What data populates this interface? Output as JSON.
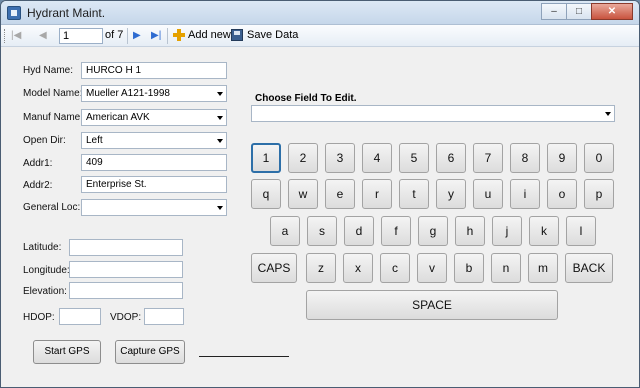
{
  "window": {
    "title": "Hydrant Maint.",
    "controls": {
      "minimize": "–",
      "maximize": "□",
      "close": "✕"
    }
  },
  "navigator": {
    "position": "1",
    "count_label": "of 7",
    "add_label": "Add new",
    "save_label": "Save Data"
  },
  "form": {
    "hyd_name": {
      "label": "Hyd Name:",
      "value": "HURCO H 1"
    },
    "model_name": {
      "label": "Model Name:",
      "value": "Mueller A121-1998"
    },
    "manuf_name": {
      "label": "Manuf Name:",
      "value": "American AVK"
    },
    "open_dir": {
      "label": "Open Dir:",
      "value": "Left"
    },
    "addr1": {
      "label": "Addr1:",
      "value": "409"
    },
    "addr2": {
      "label": "Addr2:",
      "value": "Enterprise St."
    },
    "general_loc": {
      "label": "General Loc:",
      "value": ""
    },
    "latitude": {
      "label": "Latitude:",
      "value": ""
    },
    "longitude": {
      "label": "Longitude:",
      "value": ""
    },
    "elevation": {
      "label": "Elevation:",
      "value": ""
    },
    "hdop": {
      "label": "HDOP:",
      "value": ""
    },
    "vdop": {
      "label": "VDOP:",
      "value": ""
    }
  },
  "buttons": {
    "start_gps": "Start GPS",
    "capture_gps": "Capture GPS"
  },
  "editor": {
    "choose_label": "Choose Field To Edit.",
    "selected": ""
  },
  "keyboard": {
    "row1": [
      "1",
      "2",
      "3",
      "4",
      "5",
      "6",
      "7",
      "8",
      "9",
      "0"
    ],
    "row2": [
      "q",
      "w",
      "e",
      "r",
      "t",
      "y",
      "u",
      "i",
      "o",
      "p"
    ],
    "row3": [
      "a",
      "s",
      "d",
      "f",
      "g",
      "h",
      "j",
      "k",
      "l"
    ],
    "row4": [
      "CAPS",
      "z",
      "x",
      "c",
      "v",
      "b",
      "n",
      "m",
      "BACK"
    ],
    "space": "SPACE"
  },
  "icons": {
    "first": "first-record-icon",
    "prev": "prev-record-icon",
    "next": "next-record-icon",
    "last": "last-record-icon",
    "add": "add-new-icon",
    "save": "save-icon"
  }
}
